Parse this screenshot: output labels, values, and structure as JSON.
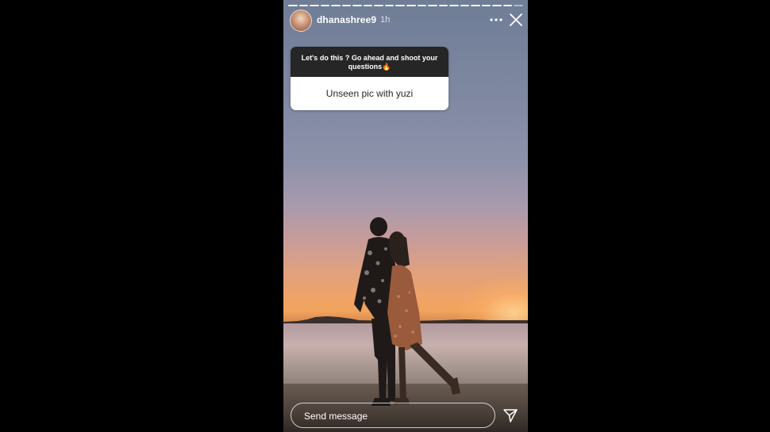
{
  "story": {
    "username": "dhanashree9",
    "time_ago": "1h",
    "progress_segments": 22,
    "icons": {
      "more": "more-horizontal-icon",
      "close": "close-icon",
      "send": "send-direct-icon"
    }
  },
  "question_sticker": {
    "prompt": "Let's do this ? Go ahead and shoot your questions🔥",
    "answer": "Unseen pic with yuzi"
  },
  "reply": {
    "placeholder": "Send message"
  },
  "colors": {
    "page_background": "#000000",
    "sticker_header": "#262626",
    "sticker_body": "#ffffff"
  }
}
